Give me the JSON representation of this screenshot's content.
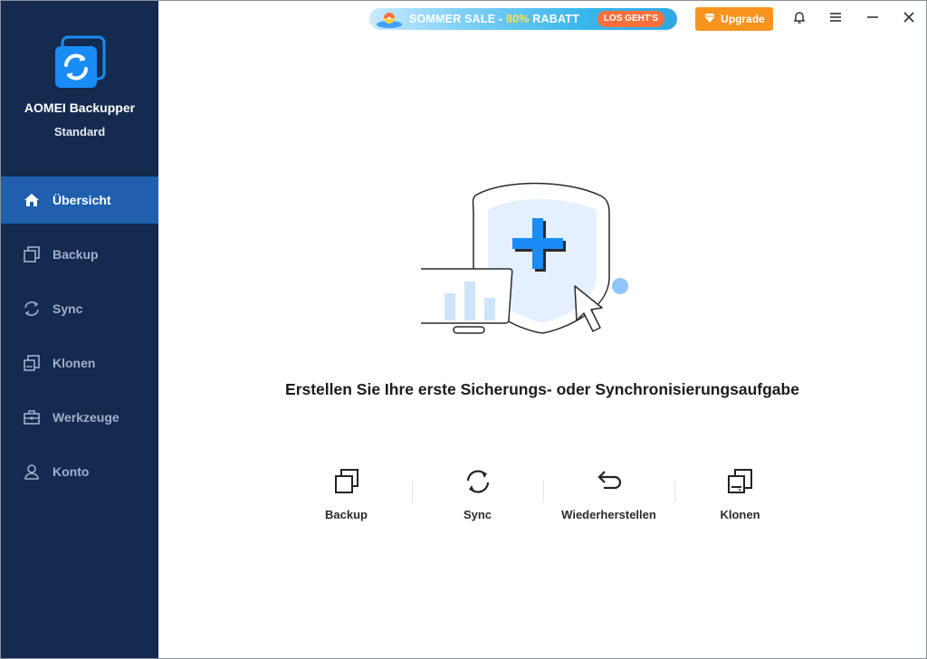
{
  "app": {
    "name": "AOMEI Backupper",
    "edition": "Standard"
  },
  "sidebar": {
    "items": [
      {
        "label": "Übersicht",
        "icon": "home-icon",
        "active": true
      },
      {
        "label": "Backup",
        "icon": "backup-icon",
        "active": false
      },
      {
        "label": "Sync",
        "icon": "sync-icon",
        "active": false
      },
      {
        "label": "Klonen",
        "icon": "clone-icon",
        "active": false
      },
      {
        "label": "Werkzeuge",
        "icon": "toolbox-icon",
        "active": false
      },
      {
        "label": "Konto",
        "icon": "user-icon",
        "active": false
      }
    ]
  },
  "topbar": {
    "promo": {
      "text_prefix": "SOMMER SALE - ",
      "percent": "80%",
      "text_suffix": " RABATT",
      "cta": "LOS GEHT'S"
    },
    "upgrade_label": "Upgrade",
    "icons": [
      "bell-icon",
      "menu-icon",
      "minimize-icon",
      "close-icon"
    ]
  },
  "main": {
    "headline": "Erstellen Sie Ihre erste Sicherungs- oder Synchronisierungsaufgabe",
    "actions": [
      {
        "label": "Backup",
        "icon": "backup-icon"
      },
      {
        "label": "Sync",
        "icon": "sync-icon"
      },
      {
        "label": "Wiederherstellen",
        "icon": "restore-icon"
      },
      {
        "label": "Klonen",
        "icon": "clone-icon"
      }
    ]
  },
  "colors": {
    "sidebar_bg": "#142a4f",
    "active_item": "#1f5fae",
    "accent_blue": "#1a8cf5",
    "upgrade_orange": "#f7941d"
  }
}
